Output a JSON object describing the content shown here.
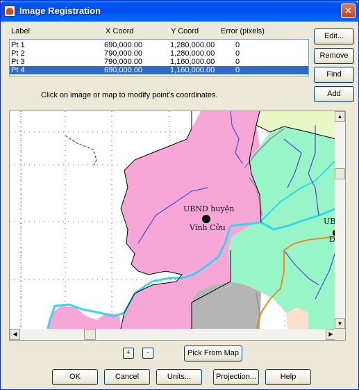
{
  "window": {
    "title": "Image Registration"
  },
  "list": {
    "headers": {
      "label": "Label",
      "x": "X Coord",
      "y": "Y Coord",
      "error": "Error (pixels)"
    },
    "rows": [
      {
        "label": "Pt 1",
        "x": "690,000.00",
        "y": "1,280,000.00",
        "error": "0",
        "selected": false
      },
      {
        "label": "Pt 2",
        "x": "790,000.00",
        "y": "1,280,000.00",
        "error": "0",
        "selected": false
      },
      {
        "label": "Pt 3",
        "x": "790,000.00",
        "y": "1,160,000.00",
        "error": "0",
        "selected": false
      },
      {
        "label": "Pt 4",
        "x": "690,000.00",
        "y": "1,160,000.00",
        "error": "0",
        "selected": true
      }
    ]
  },
  "side_buttons": {
    "edit": "Edit...",
    "remove": "Remove",
    "find": "Find",
    "add": "Add"
  },
  "hint": "Click on image or map to modify point's coordinates.",
  "map": {
    "labels": {
      "place1_line1": "UBND huyện",
      "place1_line2": "Vĩnh Cửu",
      "place2_line1": "UBND",
      "place2_line2": "Địah"
    },
    "colors": {
      "pink": "#f7a7d7",
      "green": "#98f5c8",
      "yellowgreen": "#e9f7c4",
      "gray": "#b6b6b6",
      "peach": "#fbe0cc",
      "river": "#36d6e9",
      "blue": "#3f4fd3",
      "road": "#ef8a1b"
    }
  },
  "zoom": {
    "in": "+",
    "out": "-"
  },
  "pick_from_map": "Pick From Map",
  "bottom_buttons": {
    "ok": "OK",
    "cancel": "Cancel",
    "units": "Units...",
    "projection": "Projection...",
    "help": "Help"
  }
}
